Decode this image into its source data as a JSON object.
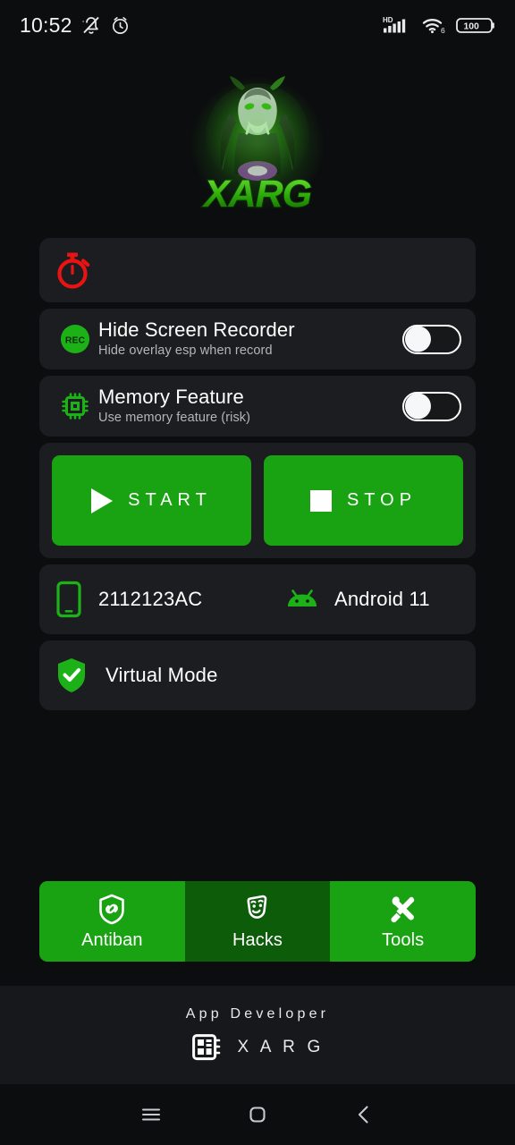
{
  "status_bar": {
    "time": "10:52",
    "icons_left": [
      "mute-icon",
      "alarm-icon"
    ],
    "network_label": "HD",
    "wifi_label": "6",
    "battery_level": "100"
  },
  "branding": {
    "logo_name": "xarg-logo",
    "logo_text": "XARG"
  },
  "timer_card": {
    "icon": "stopwatch-icon",
    "icon_color": "#e81414",
    "value": ""
  },
  "settings": [
    {
      "icon": "rec-icon",
      "icon_label": "REC",
      "title": "Hide Screen Recorder",
      "subtitle": "Hide overlay esp when record",
      "toggle_state": "off"
    },
    {
      "icon": "memory-chip-icon",
      "title": "Memory Feature",
      "subtitle": "Use memory feature (risk)",
      "toggle_state": "off"
    }
  ],
  "actions": {
    "start_label": "START",
    "stop_label": "STOP"
  },
  "device": {
    "phone_icon": "smartphone-icon",
    "model": "2112123AC",
    "android_icon": "android-robot-icon",
    "os_version": "Android 11"
  },
  "virtual_mode": {
    "icon": "shield-check-icon",
    "label": "Virtual Mode"
  },
  "tabs": [
    {
      "icon": "shield-link-icon",
      "label": "Antiban",
      "active": false
    },
    {
      "icon": "theater-mask-icon",
      "label": "Hacks",
      "active": true
    },
    {
      "icon": "tools-icon",
      "label": "Tools",
      "active": false
    }
  ],
  "footer": {
    "title": "App Developer",
    "icon": "chip-dashboard-icon",
    "developer": "X A R G"
  },
  "navbar": {
    "recents_label": "recents-icon",
    "home_label": "home-icon",
    "back_label": "back-icon"
  },
  "colors": {
    "accent_green": "#19a313",
    "active_tab_green": "#0d5c0a",
    "card_bg": "#1b1d20",
    "page_bg": "#0c0d0f",
    "red": "#e81414"
  }
}
